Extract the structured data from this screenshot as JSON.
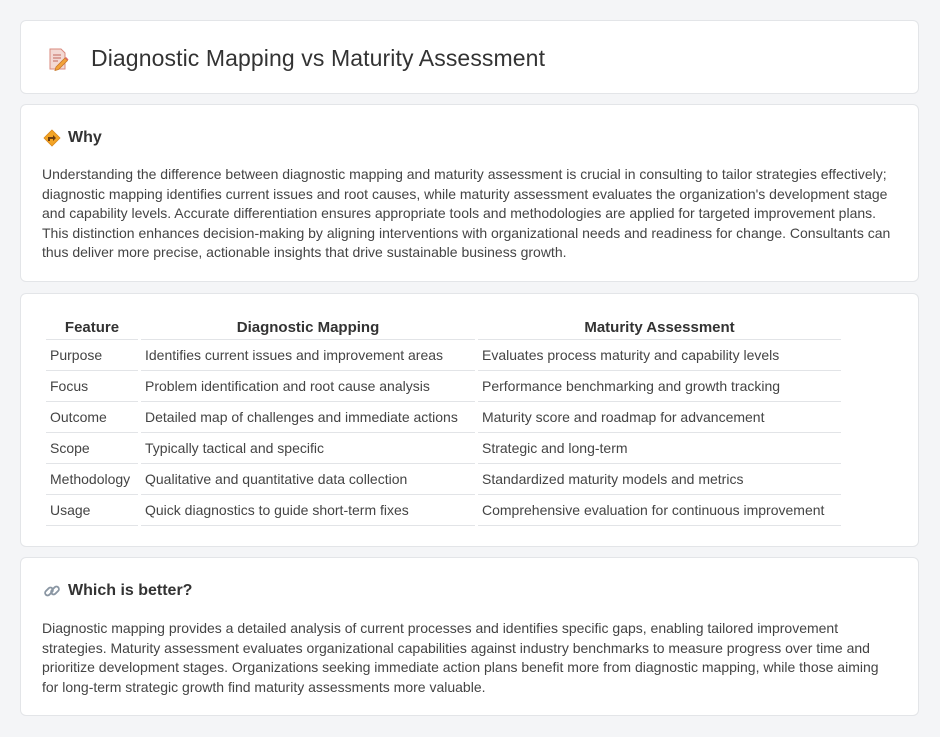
{
  "header": {
    "title": "Diagnostic Mapping vs Maturity Assessment",
    "icon": "document-pencil-icon"
  },
  "why": {
    "icon": "diamond-sign-icon",
    "title": "Why",
    "text": "Understanding the difference between diagnostic mapping and maturity assessment is crucial in consulting to tailor strategies effectively; diagnostic mapping identifies current issues and root causes, while maturity assessment evaluates the organization's development stage and capability levels. Accurate differentiation ensures appropriate tools and methodologies are applied for targeted improvement plans. This distinction enhances decision-making by aligning interventions with organizational needs and readiness for change. Consultants can thus deliver more precise, actionable insights that drive sustainable business growth."
  },
  "comparison": {
    "headers": [
      "Feature",
      "Diagnostic Mapping",
      "Maturity Assessment"
    ],
    "rows": [
      [
        "Purpose",
        "Identifies current issues and improvement areas",
        "Evaluates process maturity and capability levels"
      ],
      [
        "Focus",
        "Problem identification and root cause analysis",
        "Performance benchmarking and growth tracking"
      ],
      [
        "Outcome",
        "Detailed map of challenges and immediate actions",
        "Maturity score and roadmap for advancement"
      ],
      [
        "Scope",
        "Typically tactical and specific",
        "Strategic and long-term"
      ],
      [
        "Methodology",
        "Qualitative and quantitative data collection",
        "Standardized maturity models and metrics"
      ],
      [
        "Usage",
        "Quick diagnostics to guide short-term fixes",
        "Comprehensive evaluation for continuous improvement"
      ]
    ]
  },
  "better": {
    "icon": "link-icon",
    "title": "Which is better?",
    "text": "Diagnostic mapping provides a detailed analysis of current processes and identifies specific gaps, enabling tailored improvement strategies. Maturity assessment evaluates organizational capabilities against industry benchmarks to measure progress over time and prioritize development stages. Organizations seeking immediate action plans benefit more from diagnostic mapping, while those aiming for long-term strategic growth find maturity assessments more valuable."
  }
}
